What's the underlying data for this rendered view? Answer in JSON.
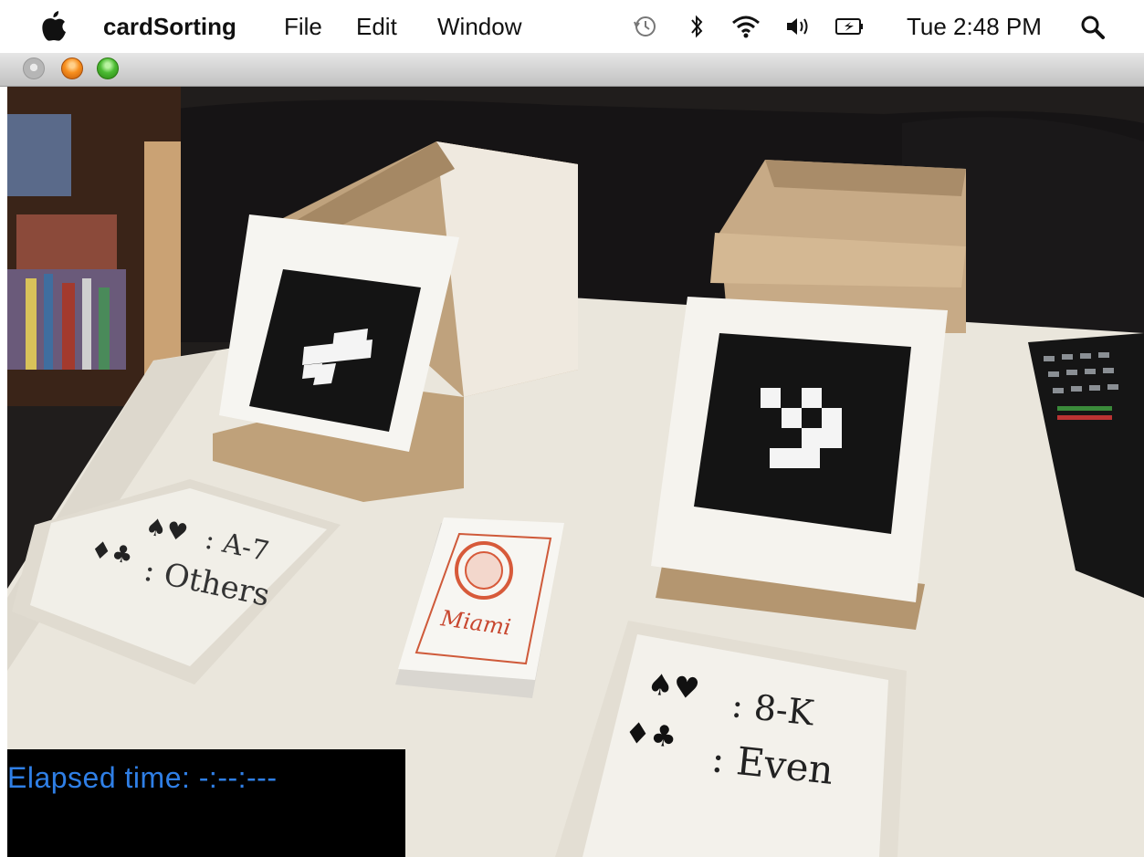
{
  "menubar": {
    "app_name": "cardSorting",
    "menus": [
      "File",
      "Edit",
      "Window"
    ],
    "status_icons": [
      "time-machine-icon",
      "bluetooth-icon",
      "wifi-icon",
      "volume-icon",
      "battery-icon"
    ],
    "clock": "Tue 2:48 PM",
    "search_icon": "magnifier-icon"
  },
  "window": {
    "traffic_lights": [
      "close",
      "minimize",
      "zoom"
    ]
  },
  "camera": {
    "left_card_lines": [
      ": A-7",
      ": Others"
    ],
    "right_card_lines": [
      ": 8-K",
      ": Even"
    ],
    "deck_label": "Miami"
  },
  "overlay": {
    "elapsed_label": "Elapsed time: -:--:---"
  },
  "colors": {
    "elapsed_text": "#2f7fe6",
    "table": "#eae6dc",
    "cardboard": "#c9ab86"
  }
}
